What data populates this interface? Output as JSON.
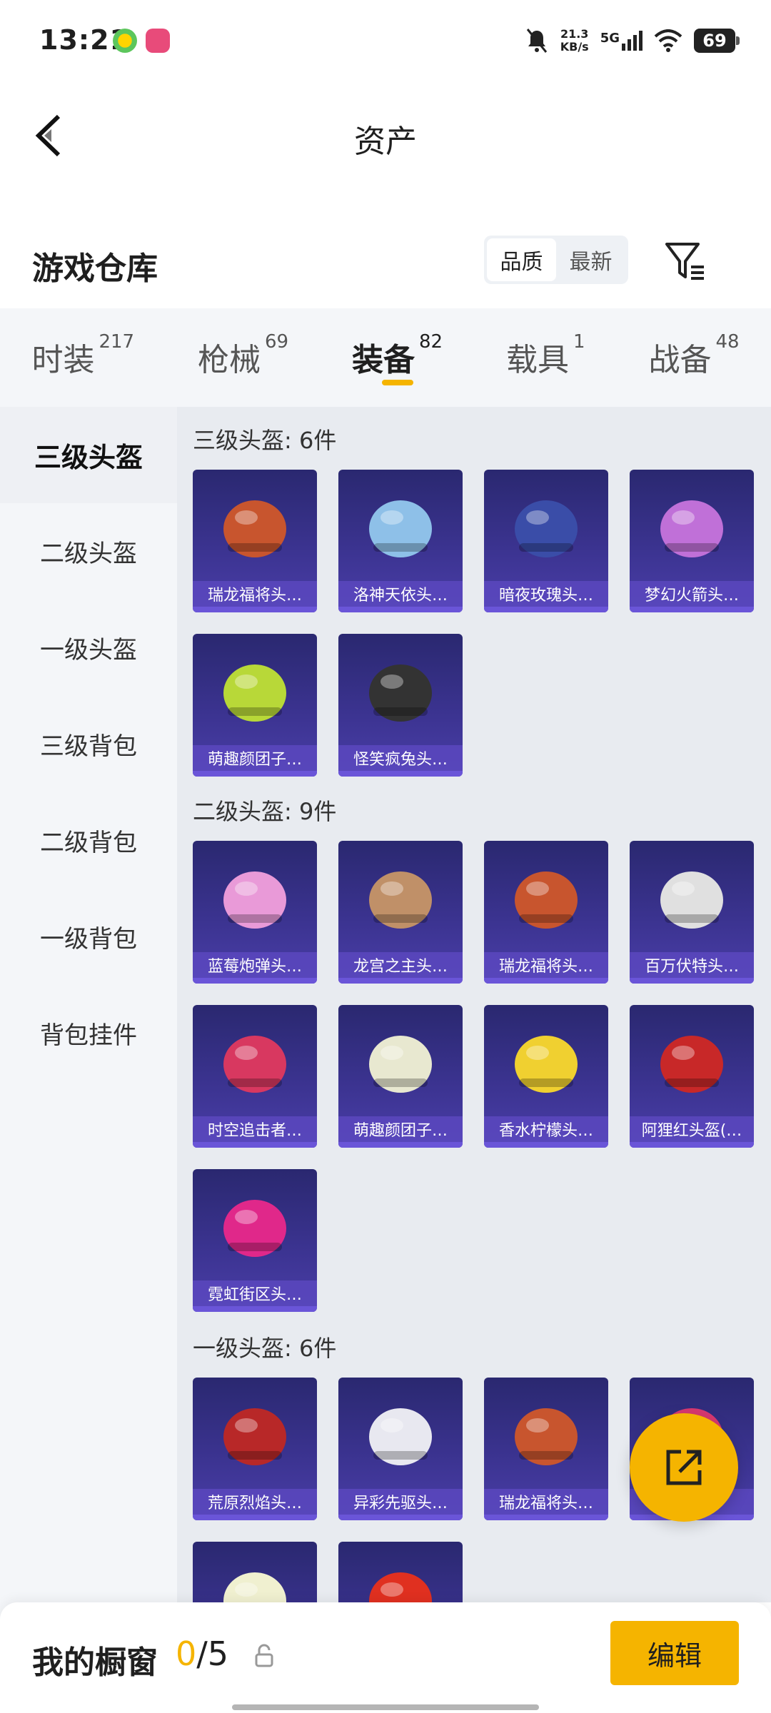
{
  "status": {
    "time": "13:21",
    "speed_value": "21.3",
    "speed_unit": "KB/s",
    "network": "5G",
    "battery": "69"
  },
  "header": {
    "title": "资产",
    "back_icon": "chevron-left-icon"
  },
  "warehouse": {
    "title": "游戏仓库",
    "sort_options": [
      "品质",
      "最新"
    ],
    "sort_active": "品质",
    "filter_icon": "filter-icon"
  },
  "categories": [
    {
      "label": "时装",
      "count": "217"
    },
    {
      "label": "枪械",
      "count": "69"
    },
    {
      "label": "装备",
      "count": "82"
    },
    {
      "label": "载具",
      "count": "1"
    },
    {
      "label": "战备",
      "count": "48"
    }
  ],
  "active_category": "装备",
  "sidebar": [
    "三级头盔",
    "二级头盔",
    "一级头盔",
    "三级背包",
    "二级背包",
    "一级背包",
    "背包挂件"
  ],
  "groups": [
    {
      "title": "三级头盔: 6件",
      "items": [
        "瑞龙福将头…",
        "洛神天依头…",
        "暗夜玫瑰头…",
        "梦幻火箭头…",
        "萌趣颜团子…",
        "怪笑疯兔头…"
      ]
    },
    {
      "title": "二级头盔: 9件",
      "items": [
        "蓝莓炮弹头…",
        "龙宫之主头…",
        "瑞龙福将头…",
        "百万伏特头…",
        "时空追击者…",
        "萌趣颜团子…",
        "香水柠檬头…",
        "阿狸红头盔(…",
        "霓虹街区头…"
      ]
    },
    {
      "title": "一级头盔: 6件",
      "items": [
        "荒原烈焰头…",
        "异彩先驱头…",
        "瑞龙福将头…",
        "",
        "",
        ""
      ]
    }
  ],
  "showcase": {
    "title": "我的橱窗",
    "used": "0",
    "sep_total": "/5",
    "edit_label": "编辑"
  },
  "colors": {
    "accent": "#f5b400",
    "card": "#3b3390"
  }
}
